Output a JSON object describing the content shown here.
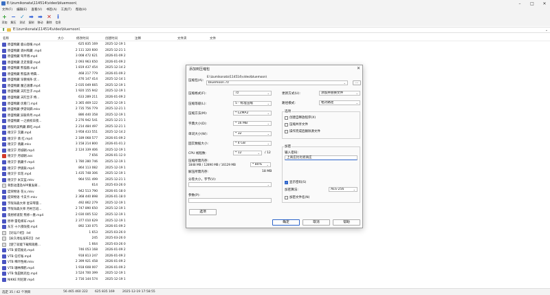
{
  "window": {
    "title": "E:\\izumikonata\\114514\\video\\bluemoon\\",
    "minimize": "–",
    "maximize": "□",
    "close": "✕"
  },
  "menu": [
    "文件(F)",
    "编辑(E)",
    "查看(V)",
    "书签(A)",
    "工具(T)",
    "帮助(H)"
  ],
  "toolbar": [
    {
      "label": "添加",
      "icon": "add-icon",
      "glyph": "+",
      "color": "#2f9e2f"
    },
    {
      "label": "解压",
      "icon": "extract-icon",
      "glyph": "−",
      "color": "#2a5bd7"
    },
    {
      "label": "测试",
      "icon": "test-icon",
      "glyph": "✓",
      "color": "#2a8ec9"
    },
    {
      "label": "复制",
      "icon": "copy-icon",
      "glyph": "➡",
      "color": "#2a5bd7"
    },
    {
      "label": "移动",
      "icon": "move-icon",
      "glyph": "➡",
      "color": "#2a5bd7"
    },
    {
      "label": "删除",
      "icon": "delete-icon",
      "glyph": "✕",
      "color": "#c62828"
    },
    {
      "label": "信息",
      "icon": "info-icon",
      "glyph": "i",
      "color": "#2a5bd7"
    }
  ],
  "address": {
    "path": "E:\\izumikonata\\114514\\video\\bluemoon\\"
  },
  "columns": {
    "name": "名称",
    "size": "大小",
    "modified": "修改时间",
    "created": "创建时间",
    "comment": "注释",
    "folders": "文件夹",
    "files": "文件"
  },
  "files": [
    {
      "name": "原盛物藏 鹿山恩植.mp4",
      "size": "625 835 169",
      "mod": "2025-12-19 1",
      "kind": "video"
    },
    {
      "name": "原盛物藏 调州和藏 .mp4",
      "size": "2 111 320 600",
      "mod": "2025-12-21 1",
      "kind": "video"
    },
    {
      "name": "原盛物藏 驾平博.mp4",
      "size": "3 008 472 621",
      "mod": "2026-01-09 2",
      "kind": "video"
    },
    {
      "name": "原盛物藏 走走策雷.mp4",
      "size": "2 093 963 650",
      "mod": "2026-01-09 2",
      "kind": "video"
    },
    {
      "name": "原盛物藏 熊猫猿.mp4",
      "size": "1 819 437 454",
      "mod": "2025-12-14 2",
      "kind": "video"
    },
    {
      "name": "原盛物藏 熊猫清 特典...",
      "size": "468 217 779",
      "mod": "2026-01-09 2",
      "kind": "video"
    },
    {
      "name": "原盛物藏 早教线条 优...",
      "size": "476 147 414",
      "mod": "2025-12-14 1",
      "kind": "video"
    },
    {
      "name": "原盛物藏 魔己速爆.mp4",
      "size": "2 035 049 665",
      "mod": "2025-12-19 1",
      "kind": "video"
    },
    {
      "name": "原盛物藏 天陀至子.mp4",
      "size": "1 920 155 942",
      "mod": "2025-12-19 1",
      "kind": "video"
    },
    {
      "name": "原盛物藏 天陀至子 特...",
      "size": "633 289 211",
      "mod": "2026-01-09 2",
      "kind": "video"
    },
    {
      "name": "原盛物藏 优看门.mp4",
      "size": "3 365 469 122",
      "mod": "2025-12-19 1",
      "kind": "video"
    },
    {
      "name": "原盛物藏 伊游同麻.mkv",
      "size": "2 735 756 779",
      "mod": "2025-12-21 1",
      "kind": "video"
    },
    {
      "name": "原盛物藏 异联单月.mp4",
      "size": "886 440 358",
      "mod": "2025-12-19 1",
      "kind": "video"
    },
    {
      "name": "原盛物藏 一之桃校日夜...",
      "size": "2 276 942 541",
      "mod": "2025-12-21 1",
      "kind": "video"
    },
    {
      "name": "原版的美鸭藏 麻吃.mp4",
      "size": "2 214 484 497",
      "mod": "2025-12-21 1",
      "kind": "video"
    },
    {
      "name": "德汉宁 交藏.mp4",
      "size": "3 958 433 551",
      "mod": "2025-12-14 2",
      "kind": "video"
    },
    {
      "name": "德汉宁 翡 红.mp4",
      "size": "2 189 068 577",
      "mod": "2026-01-09 2",
      "kind": "video"
    },
    {
      "name": "德汉宁 翡藏.mkv",
      "size": "3 158 214 800",
      "mod": "2026-01-01 2",
      "kind": "video"
    },
    {
      "name": "德汉宁 月城朝.mp4",
      "size": "2 124 339 406",
      "mod": "2025-12-19 1",
      "kind": "video"
    },
    {
      "name": "德汉宁 月城朝.ass",
      "size": "7 656",
      "mod": "2026-01-12 0",
      "kind": "sub"
    },
    {
      "name": "德汉宁 鹤藏卡.mp4",
      "size": "1 780 280 746",
      "mod": "2025-12-19 1",
      "kind": "video"
    },
    {
      "name": "德汉宁 伊奥联.mp4",
      "size": "864 113 082",
      "mod": "2025-12-19 1",
      "kind": "video"
    },
    {
      "name": "德汉宁 伝花.mp4",
      "size": "1 435 748 306",
      "mod": "2025-12-19 1",
      "kind": "video"
    },
    {
      "name": "德汉宁 米又蓝.mkv",
      "size": "964 551 499",
      "mod": "2025-12-21 1",
      "kind": "video"
    },
    {
      "name": "骨影动漫及APP重发邮...",
      "size": "614",
      "mod": "2025-03-26 0",
      "kind": "text"
    },
    {
      "name": "度荣物语 花火.mkv",
      "size": "942 513 790",
      "mod": "2026-01-18 0",
      "kind": "video"
    },
    {
      "name": "度荣物语 卡夫卡.mkv",
      "size": "2 368 440 898",
      "mod": "2026-01-18 0",
      "kind": "video"
    },
    {
      "name": "字限海森大师 星日琴雷...",
      "size": "492 862 279",
      "mod": "2025-12-19 1",
      "kind": "video"
    },
    {
      "name": "字限海森大师 月村吉班...",
      "size": "2 747 890 650",
      "mod": "2025-12-19 1",
      "kind": "video"
    },
    {
      "name": "夜想修道院 熊修一墨.mp4",
      "size": "2 030 005 532",
      "mod": "2025-12-19 1",
      "kind": "video"
    },
    {
      "name": "原神 雷电将军.mp4",
      "size": "2 377 010 629",
      "mod": "2025-12-19 1",
      "kind": "video"
    },
    {
      "name": "东方 十六夜咲夜.mp4",
      "size": "892 130 075",
      "mod": "2026-01-09 2",
      "kind": "video"
    },
    {
      "name": "【论坛介绍】.txt",
      "size": "1 653",
      "mod": "2025-03-26 0",
      "kind": "text"
    },
    {
      "name": "【永久地址发布页】.txt",
      "size": "245",
      "mod": "2025-03-26 0",
      "kind": "text"
    },
    {
      "name": "【使了就能下载和观看...",
      "size": "1 664",
      "mod": "2025-03-26 0",
      "kind": "text"
    },
    {
      "name": "VTB 索花秘光.mp4",
      "size": "746 053 168",
      "mod": "2026-01-09 2",
      "kind": "video"
    },
    {
      "name": "VTB 信打账.mp4",
      "size": "918 813 247",
      "mod": "2026-01-09 2",
      "kind": "video"
    },
    {
      "name": "VTB 稀叶性阐.mkv",
      "size": "2 399 921 458",
      "mod": "2026-01-09 2",
      "kind": "video"
    },
    {
      "name": "VTB 珊林拜鹤.mp4",
      "size": "1 918 608 007",
      "mod": "2026-01-09 2",
      "kind": "video"
    },
    {
      "name": "VTB 兔田佩克拉.mp4",
      "size": "3 524 700 399",
      "mod": "2025-12-19 1",
      "kind": "video"
    },
    {
      "name": "NIKKE 阿尼斯.mp4",
      "size": "2 716 144 574",
      "mod": "2025-12-19 1",
      "kind": "video"
    }
  ],
  "status": {
    "selection": "选定 35 / 42 个项目",
    "total": "56 465 460 222",
    "packed": "625 835 169",
    "date": "2025-12-19 17:58:55"
  },
  "dialog": {
    "title": "添加到压缩包",
    "close": "✕",
    "archive_label": "压缩包(A):",
    "archive_dir": "E:\\izumikonata\\114514\\video\\bluemoon\\",
    "archive_name": "bluemoon.7z",
    "browse": "...",
    "format_label": "压缩格式(F):",
    "format_value": "7z",
    "level_label": "压缩等级(L):",
    "level_value": "5 - 标准压缩",
    "method_label": "压缩方法(M):",
    "method_value": "* LZMA2",
    "dict_label": "字典大小(D):",
    "dict_value": "* 16 MB",
    "word_label": "单词大小(W):",
    "word_value": "* 32",
    "solid_label": "固实数据大小:",
    "solid_value": "* 4 GB",
    "cpu_label": "CPU 线程数:",
    "cpu_value": "* 12",
    "cpu_max": "/ 12",
    "mem_label": "压缩所需内存:",
    "mem_detail": "1848 MB / 12890 MB / 16129 MB",
    "mem_pct": "* 80%",
    "dmem_label": "解压所需内存:",
    "dmem_value": "18 MB",
    "split_label": "分卷大小，字节(V):",
    "params_label": "参数(P):",
    "options_button": "选项",
    "update_label": "更新方式(U):",
    "update_value": "添加并替换文件",
    "pathmode_label": "路径模式:",
    "pathmode_value": "相对路径",
    "opts_group": "选项",
    "opt_sfx": "创建自释放程序(X)",
    "opt_shared": "压缩共享文件",
    "opt_delete": "操作完成后删除源文件",
    "enc_group": "加密",
    "pw_label": "输入密码:",
    "pw_value": "上高庄比比遮高庄",
    "show_pw": "显示密码(S)",
    "enc_method_label": "加密算法:",
    "enc_method_value": "AES-256",
    "enc_names": "加密文件名(N)",
    "ok": "确定",
    "cancel": "取消",
    "help": "帮助"
  },
  "colors": {
    "video_icon": "#4a54c2",
    "text_icon": "#dcdcdc",
    "sub_icon": "#d23a2a",
    "accent": "#2a62c9"
  }
}
